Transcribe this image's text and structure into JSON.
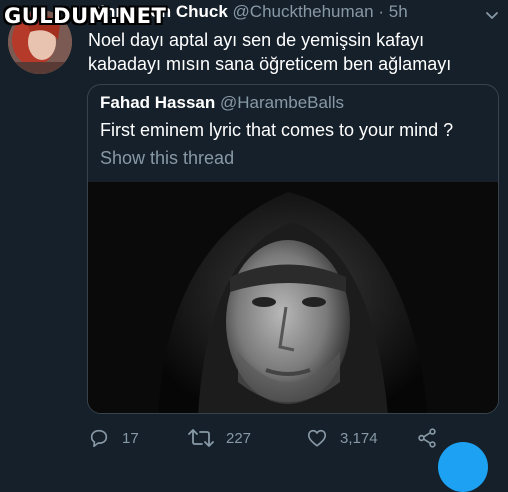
{
  "watermark": "GULDUM.NET",
  "tweet": {
    "display_name": "Cinnamon Chuck",
    "handle": "@Chuckthehuman",
    "separator": "·",
    "time": "5h",
    "text_lines": [
      "Noel dayı aptal ayı sen de yemişsin kafayı",
      "kabadayı mısın sana öğreticem ben ağlamayı"
    ]
  },
  "quoted": {
    "display_name": "Fahad Hassan",
    "handle": "@HarambeBalls",
    "text": "First eminem lyric that comes to your mind ?",
    "show_thread": "Show this thread"
  },
  "actions": {
    "replies": "17",
    "retweets": "227",
    "likes": "3,174"
  },
  "colors": {
    "background": "#15202b",
    "secondary_text": "#8899a6",
    "border": "#38444d",
    "accent": "#1da1f2"
  }
}
